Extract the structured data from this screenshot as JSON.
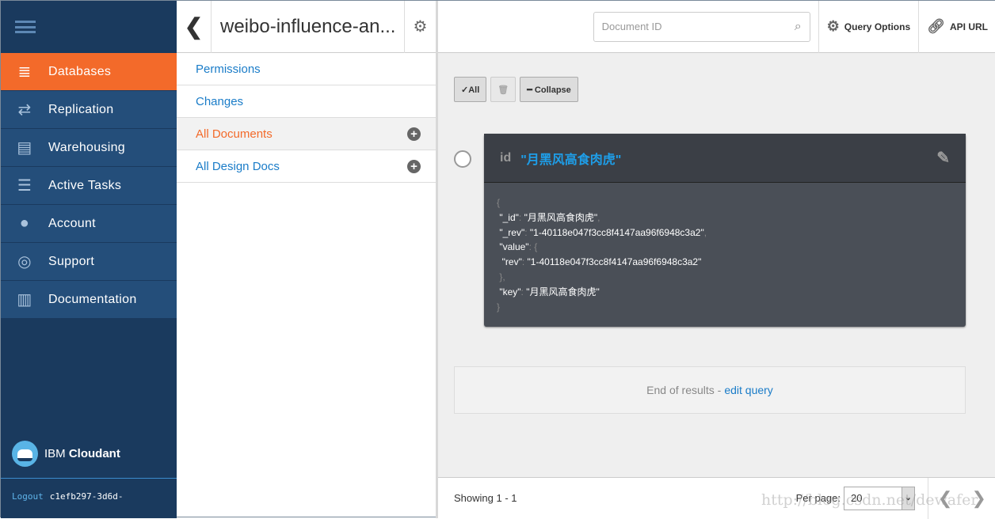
{
  "sidebar": {
    "items": [
      {
        "label": "Databases",
        "icon": "database-icon",
        "active": true
      },
      {
        "label": "Replication",
        "icon": "replication-icon"
      },
      {
        "label": "Warehousing",
        "icon": "warehouse-icon"
      },
      {
        "label": "Active Tasks",
        "icon": "tasks-icon"
      },
      {
        "label": "Account",
        "icon": "user-icon"
      },
      {
        "label": "Support",
        "icon": "lifebuoy-icon"
      },
      {
        "label": "Documentation",
        "icon": "book-icon"
      }
    ],
    "brand_ibm": "IBM",
    "brand_name": "Cloudant",
    "logout": "Logout",
    "user": "c1efb297-3d6d-"
  },
  "db": {
    "name": "weibo-influence-an...",
    "menu": [
      {
        "label": "Permissions"
      },
      {
        "label": "Changes"
      },
      {
        "label": "All Documents"
      },
      {
        "label": "All Design Docs"
      }
    ]
  },
  "toolbar": {
    "search_placeholder": "Document ID",
    "query_options": "Query Options",
    "api_url": "API URL",
    "all": "✓All",
    "collapse": "━ Collapse"
  },
  "doc": {
    "id_label": "id",
    "id_value": "\"月黑风高食肉虎\"",
    "json": {
      "l1": "{",
      "id_key": "\"_id\"",
      "id_val": "\"月黑风高食肉虎\"",
      "rev_key": "\"_rev\"",
      "rev_val": "\"1-40118e047f3cc8f4147aa96f6948c3a2\"",
      "value_key": "\"value\"",
      "vrev_key": "\"rev\"",
      "vrev_val": "\"1-40118e047f3cc8f4147aa96f6948c3a2\"",
      "key_key": "\"key\"",
      "key_val": "\"月黑风高食肉虎\"",
      "close": "}"
    }
  },
  "results": {
    "end_text": "End of results -",
    "edit_query": "edit query",
    "showing": "Showing 1 - 1",
    "per_page_label": "Per page:",
    "per_page": "20"
  },
  "watermark": "http://blog.csdn.net/dewafer",
  "colors": {
    "accent": "#f36a2a",
    "sidebar": "#1a3a5e",
    "link": "#1a7cc8"
  }
}
